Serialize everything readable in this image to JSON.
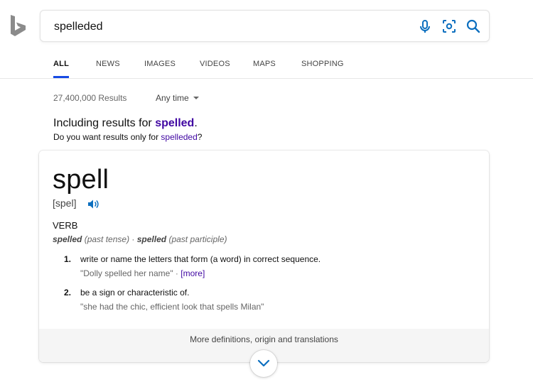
{
  "colors": {
    "accent": "#174ae4",
    "link": "#4007a2",
    "icon_blue": "#0c6fbf",
    "logo": "#8b8b8b"
  },
  "search": {
    "query": "spelleded",
    "icons": [
      "microphone-icon",
      "visual-search-icon",
      "search-icon"
    ]
  },
  "tabs": [
    {
      "label": "ALL",
      "active": true
    },
    {
      "label": "NEWS"
    },
    {
      "label": "IMAGES"
    },
    {
      "label": "VIDEOS"
    },
    {
      "label": "MAPS"
    },
    {
      "label": "SHOPPING"
    }
  ],
  "results": {
    "count": "27,400,000 Results",
    "time_filter": "Any time"
  },
  "spelling": {
    "including_prefix": "Including results for ",
    "including_term": "spelled",
    "including_suffix": ".",
    "dym_prefix": "Do you want results only for ",
    "dym_term": "spelleded",
    "dym_suffix": "?"
  },
  "definition": {
    "word": "spell",
    "pronunciation": "[spel]",
    "part_of_speech": "VERB",
    "forms": [
      {
        "form": "spelled",
        "note": "(past tense)"
      },
      {
        "form": "spelled",
        "note": "(past participle)"
      }
    ],
    "form_separator": " · ",
    "senses": [
      {
        "num": "1.",
        "text": "write or name the letters that form (a word) in correct sequence.",
        "example": "\"Dolly spelled her name\"",
        "more_sep": " · ",
        "more": "[more]"
      },
      {
        "num": "2.",
        "text": "be a sign or characteristic of.",
        "example": "\"she had the chic, efficient look that spells Milan\""
      }
    ],
    "more_link": "More definitions, origin and translations"
  }
}
